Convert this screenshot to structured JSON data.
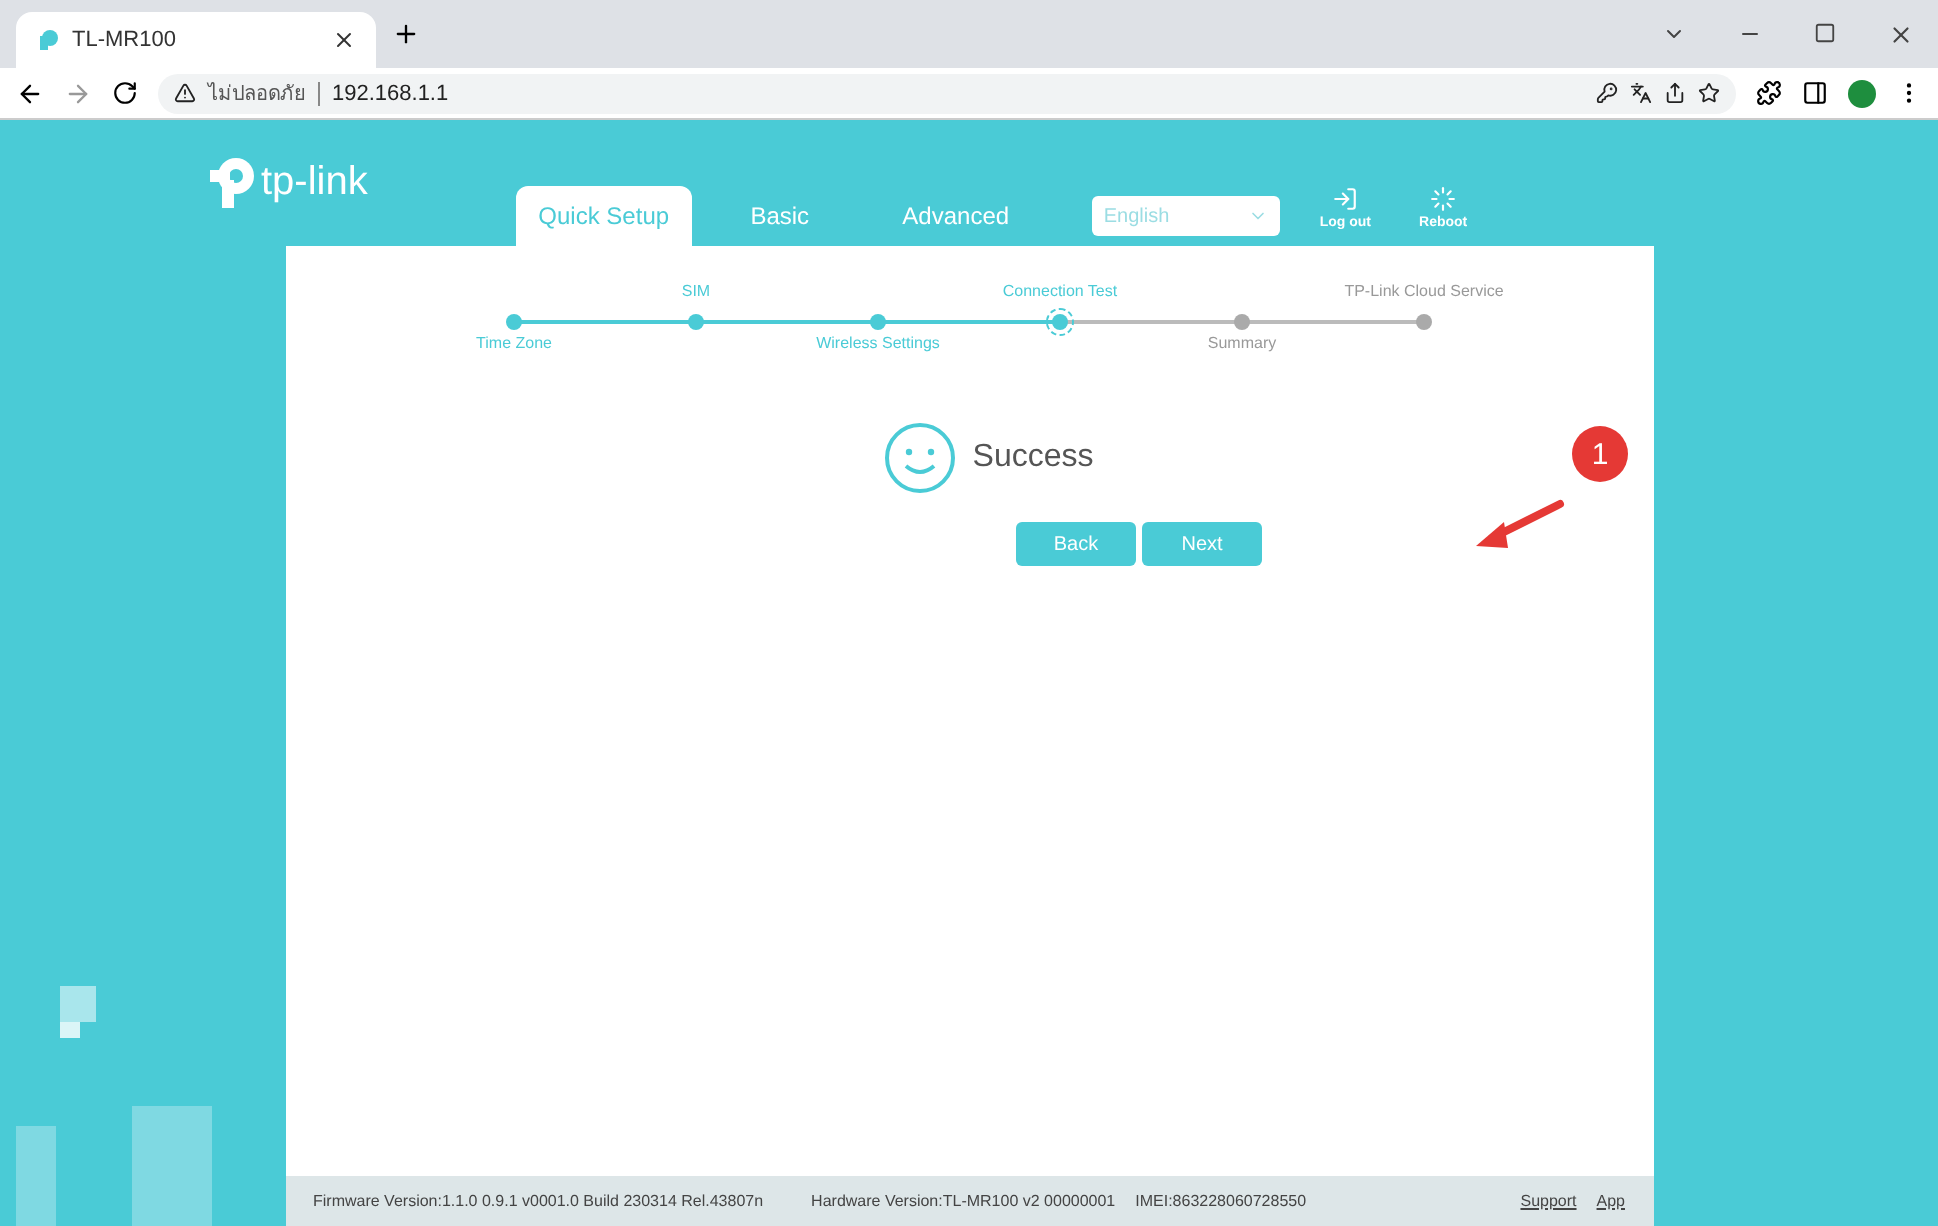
{
  "browser": {
    "tab_title": "TL-MR100",
    "security_label": "ไม่ปลอดภัย",
    "address": "192.168.1.1"
  },
  "header": {
    "logo_text": "tp-link",
    "tabs": [
      {
        "label": "Quick Setup",
        "selected": true
      },
      {
        "label": "Basic",
        "selected": false
      },
      {
        "label": "Advanced",
        "selected": false
      }
    ],
    "language": "English",
    "actions": [
      {
        "kind": "logout",
        "label": "Log out"
      },
      {
        "kind": "reboot",
        "label": "Reboot"
      }
    ]
  },
  "steps": [
    {
      "label": "Time Zone",
      "done": true,
      "selected": false
    },
    {
      "label": "SIM",
      "done": true,
      "selected": false
    },
    {
      "label": "Wireless Settings",
      "done": true,
      "selected": false
    },
    {
      "label": "Connection Test",
      "done": true,
      "selected": true
    },
    {
      "label": "Summary",
      "done": false,
      "selected": false
    },
    {
      "label": "TP-Link Cloud Service",
      "done": false,
      "selected": false
    }
  ],
  "result": {
    "message": "Success"
  },
  "buttons": [
    {
      "label": "Back"
    },
    {
      "label": "Next"
    }
  ],
  "annotation": {
    "number": "1"
  },
  "footer": {
    "firmware": "Firmware Version:1.1.0 0.9.1 v0001.0 Build 230314 Rel.43807n",
    "hardware": "Hardware Version:TL-MR100 v2 00000001",
    "imei": "IMEI:863228060728550",
    "links": [
      "Support",
      "App"
    ]
  }
}
